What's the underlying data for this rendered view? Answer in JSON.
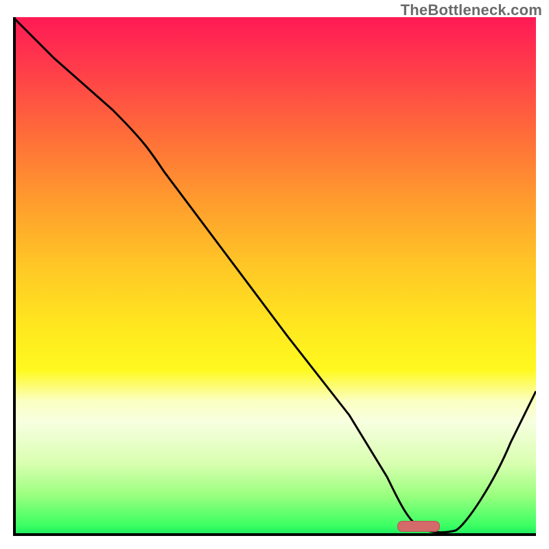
{
  "watermark": "TheBottleneck.com",
  "colors": {
    "curve": "#000000",
    "axis": "#000000",
    "marker": "#d46a6a",
    "gradient_top": "#ff1a55",
    "gradient_bottom": "#17e85e"
  },
  "chart_data": {
    "type": "line",
    "title": "",
    "xlabel": "",
    "ylabel": "",
    "xlim": [
      0,
      100
    ],
    "ylim": [
      0,
      100
    ],
    "gradient_meaning": "top = high bottleneck (red), bottom = low bottleneck (green)",
    "marker": {
      "x_start": 74,
      "x_end": 82,
      "y": 2
    },
    "series": [
      {
        "name": "bottleneck-curve",
        "x": [
          0,
          10,
          20,
          28,
          35,
          45,
          55,
          65,
          72,
          75,
          80,
          84,
          90,
          95,
          100
        ],
        "y": [
          100,
          90,
          80,
          72,
          62,
          48,
          34,
          20,
          10,
          3,
          2,
          3,
          12,
          20,
          28
        ]
      }
    ]
  }
}
